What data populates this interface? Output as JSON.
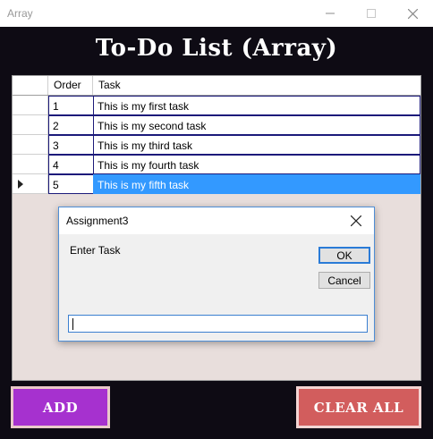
{
  "window": {
    "title": "Array",
    "controls": {
      "minimize_icon": "minimize-icon",
      "maximize_icon": "maximize-icon",
      "close_icon": "close-icon"
    }
  },
  "app": {
    "title": "To-Do List (Array)"
  },
  "grid": {
    "columns": [
      "Order",
      "Task"
    ],
    "rows": [
      {
        "order": "1",
        "task": "This is my first task",
        "selected": false
      },
      {
        "order": "2",
        "task": "This is my second task",
        "selected": false
      },
      {
        "order": "3",
        "task": "This is my third task",
        "selected": false
      },
      {
        "order": "4",
        "task": "This is my fourth task",
        "selected": false
      },
      {
        "order": "5",
        "task": "This is my fifth task",
        "selected": true
      }
    ],
    "current_row_icon": "row-pointer-icon"
  },
  "buttons": {
    "add_label": "ADD",
    "clear_label": "CLEAR ALL"
  },
  "dialog": {
    "title": "Assignment3",
    "prompt": "Enter Task",
    "ok_label": "OK",
    "cancel_label": "Cancel",
    "input_value": ""
  },
  "colors": {
    "background": "#0e0b14",
    "grid_background": "#e8dedc",
    "selection": "#3399ff",
    "add_button": "#a631cf",
    "clear_button": "#d25d5d"
  }
}
